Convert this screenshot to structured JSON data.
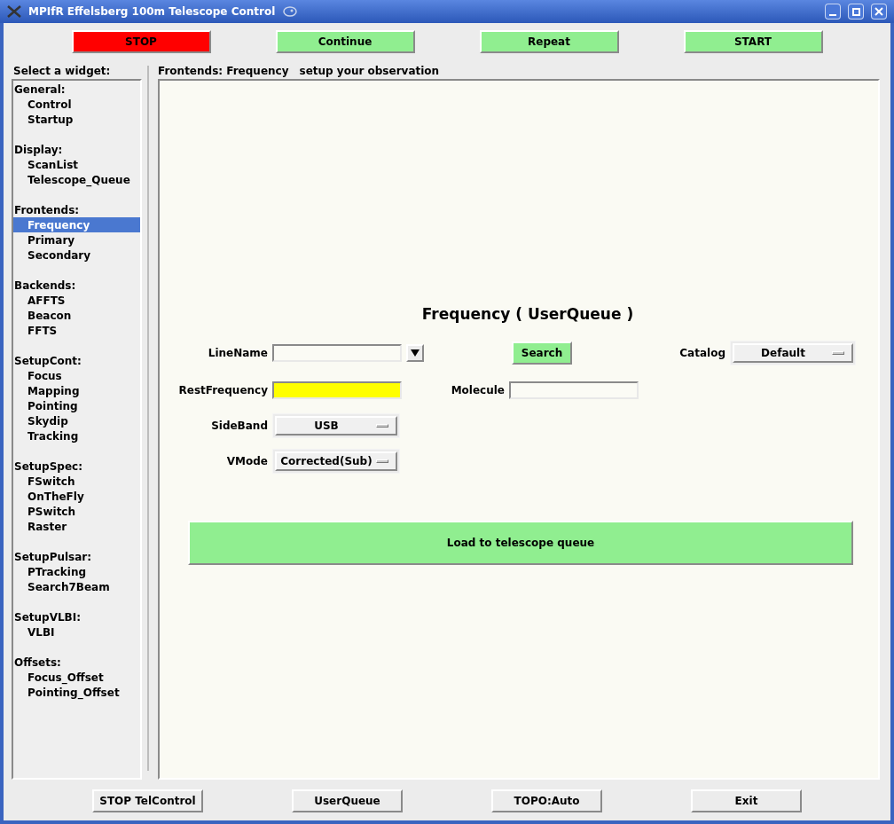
{
  "window": {
    "title": "MPIfR Effelsberg 100m Telescope Control"
  },
  "top_buttons": [
    {
      "label": "STOP",
      "kind": "stop"
    },
    {
      "label": "Continue",
      "kind": "go"
    },
    {
      "label": "Repeat",
      "kind": "go"
    },
    {
      "label": "START",
      "kind": "go"
    }
  ],
  "sidebar": {
    "heading": "Select a widget:",
    "groups": [
      {
        "label": "General:",
        "items": [
          {
            "label": "Control",
            "selected": false
          },
          {
            "label": "Startup",
            "selected": false
          }
        ]
      },
      {
        "label": "Display:",
        "items": [
          {
            "label": "ScanList",
            "selected": false
          },
          {
            "label": "Telescope_Queue",
            "selected": false
          }
        ]
      },
      {
        "label": "Frontends:",
        "items": [
          {
            "label": "Frequency",
            "selected": true
          },
          {
            "label": "Primary",
            "selected": false
          },
          {
            "label": "Secondary",
            "selected": false
          }
        ]
      },
      {
        "label": "Backends:",
        "items": [
          {
            "label": "AFFTS",
            "selected": false
          },
          {
            "label": "Beacon",
            "selected": false
          },
          {
            "label": "FFTS",
            "selected": false
          }
        ]
      },
      {
        "label": "SetupCont:",
        "items": [
          {
            "label": "Focus",
            "selected": false
          },
          {
            "label": "Mapping",
            "selected": false
          },
          {
            "label": "Pointing",
            "selected": false
          },
          {
            "label": "Skydip",
            "selected": false
          },
          {
            "label": "Tracking",
            "selected": false
          }
        ]
      },
      {
        "label": "SetupSpec:",
        "items": [
          {
            "label": "FSwitch",
            "selected": false
          },
          {
            "label": "OnTheFly",
            "selected": false
          },
          {
            "label": "PSwitch",
            "selected": false
          },
          {
            "label": "Raster",
            "selected": false
          }
        ]
      },
      {
        "label": "SetupPulsar:",
        "items": [
          {
            "label": "PTracking",
            "selected": false
          },
          {
            "label": "Search7Beam",
            "selected": false
          }
        ]
      },
      {
        "label": "SetupVLBI:",
        "items": [
          {
            "label": "VLBI",
            "selected": false
          }
        ]
      },
      {
        "label": "Offsets:",
        "items": [
          {
            "label": "Focus_Offset",
            "selected": false
          },
          {
            "label": "Pointing_Offset",
            "selected": false
          }
        ]
      }
    ]
  },
  "panel": {
    "path": "Frontends: Frequency",
    "hint": "setup your observation",
    "form": {
      "title": "Frequency ( UserQueue )",
      "line_name": {
        "label": "LineName"
      },
      "search_button": "Search",
      "catalog": {
        "label": "Catalog",
        "value": "Default"
      },
      "rest_frequency": {
        "label": "RestFrequency",
        "highlighted": true
      },
      "molecule": {
        "label": "Molecule"
      },
      "side_band": {
        "label": "SideBand",
        "value": "USB"
      },
      "vmode": {
        "label": "VMode",
        "value": "Corrected(Sub)"
      },
      "load_button": "Load to telescope queue"
    }
  },
  "bottom_buttons": [
    "STOP TelControl",
    "UserQueue",
    "TOPO:Auto",
    "Exit"
  ]
}
